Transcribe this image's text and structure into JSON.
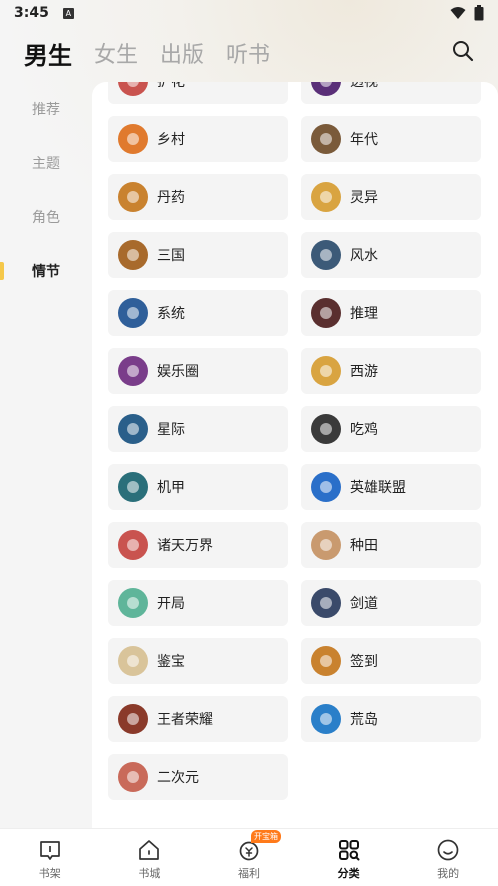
{
  "status_bar": {
    "time": "3:45",
    "notification_icon": "A"
  },
  "header": {
    "tabs": [
      {
        "label": "男生",
        "active": true
      },
      {
        "label": "女生",
        "active": false
      },
      {
        "label": "出版",
        "active": false
      },
      {
        "label": "听书",
        "active": false
      }
    ],
    "search_icon": "search-icon"
  },
  "sidebar": {
    "items": [
      {
        "label": "推荐",
        "active": false
      },
      {
        "label": "主题",
        "active": false
      },
      {
        "label": "角色",
        "active": false
      },
      {
        "label": "情节",
        "active": true
      }
    ]
  },
  "categories": [
    {
      "label": "护花",
      "color": "#c9534f"
    },
    {
      "label": "透视",
      "color": "#5a2f78"
    },
    {
      "label": "乡村",
      "color": "#e07a2e"
    },
    {
      "label": "年代",
      "color": "#7a5a3a"
    },
    {
      "label": "丹药",
      "color": "#c9822f"
    },
    {
      "label": "灵异",
      "color": "#d9a441"
    },
    {
      "label": "三国",
      "color": "#a86a2c"
    },
    {
      "label": "风水",
      "color": "#3c5a78"
    },
    {
      "label": "系统",
      "color": "#2f5f9a"
    },
    {
      "label": "推理",
      "color": "#5a2f2f"
    },
    {
      "label": "娱乐圈",
      "color": "#7a3d8a"
    },
    {
      "label": "西游",
      "color": "#d9a441"
    },
    {
      "label": "星际",
      "color": "#2a5f8a"
    },
    {
      "label": "吃鸡",
      "color": "#3a3a3a"
    },
    {
      "label": "机甲",
      "color": "#2a6f7a"
    },
    {
      "label": "英雄联盟",
      "color": "#2a6fc9"
    },
    {
      "label": "诸天万界",
      "color": "#c9534f"
    },
    {
      "label": "种田",
      "color": "#c99a6f"
    },
    {
      "label": "开局",
      "color": "#5fb59a"
    },
    {
      "label": "剑道",
      "color": "#3a4a6a"
    },
    {
      "label": "鉴宝",
      "color": "#d9c49a"
    },
    {
      "label": "签到",
      "color": "#c9822f"
    },
    {
      "label": "王者荣耀",
      "color": "#8a3a2a"
    },
    {
      "label": "荒岛",
      "color": "#2a7fc9"
    },
    {
      "label": "二次元",
      "color": "#c96a5a"
    }
  ],
  "bottom_nav": {
    "items": [
      {
        "label": "书架",
        "icon": "bookshelf-icon",
        "active": false
      },
      {
        "label": "书城",
        "icon": "bookstore-icon",
        "active": false
      },
      {
        "label": "福利",
        "icon": "welfare-icon",
        "active": false,
        "badge": "开宝箱"
      },
      {
        "label": "分类",
        "icon": "category-icon",
        "active": true
      },
      {
        "label": "我的",
        "icon": "profile-icon",
        "active": false
      }
    ]
  }
}
